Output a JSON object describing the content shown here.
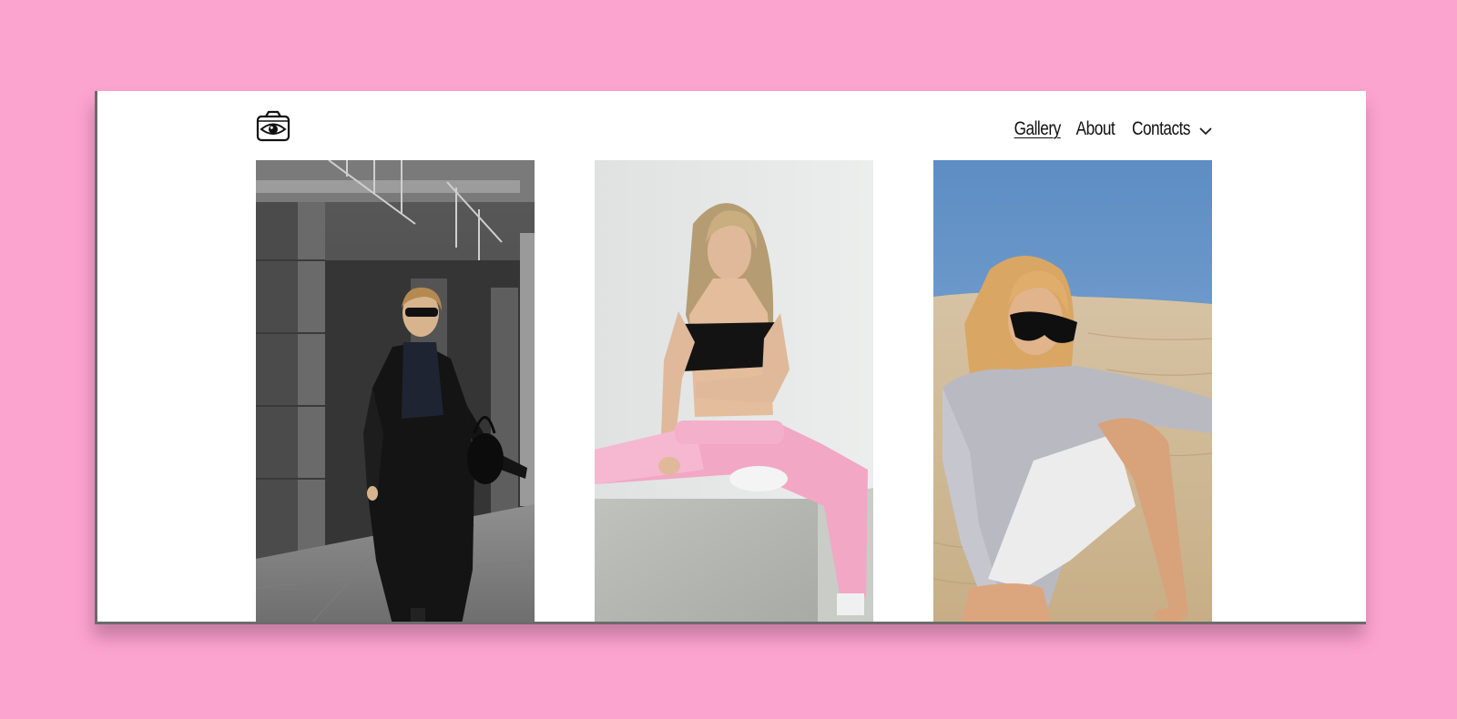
{
  "app": {
    "logo_icon": "camera-eye-icon"
  },
  "nav": {
    "items": [
      {
        "label": "Gallery",
        "active": true
      },
      {
        "label": "About",
        "active": false
      },
      {
        "label": "Contacts",
        "active": false
      }
    ],
    "dropdown_icon": "chevron-down-icon"
  },
  "gallery": {
    "photos": [
      {
        "subject": "woman-in-black-coat-urban",
        "icon": "photo"
      },
      {
        "subject": "woman-in-pink-sweatpants-studio",
        "icon": "photo"
      },
      {
        "subject": "woman-in-grey-sweater-desert",
        "icon": "photo"
      }
    ]
  },
  "colors": {
    "background": "#fca4d0",
    "window": "#ffffff",
    "text": "#111111"
  }
}
